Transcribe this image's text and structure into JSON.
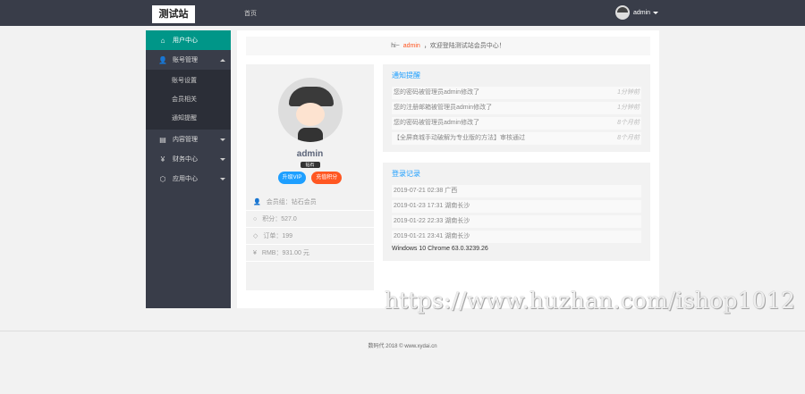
{
  "header": {
    "logo": "测试站",
    "home": "首页",
    "username": "admin"
  },
  "sidebar": {
    "items": [
      {
        "label": "用户中心",
        "icon": "home-icon",
        "active": true
      },
      {
        "label": "账号管理",
        "icon": "user-icon",
        "expanded": true,
        "children": [
          "账号设置",
          "会员相关",
          "通知提醒"
        ]
      },
      {
        "label": "内容管理",
        "icon": "list-icon"
      },
      {
        "label": "财务中心",
        "icon": "yen-icon"
      },
      {
        "label": "应用中心",
        "icon": "cube-icon"
      }
    ]
  },
  "welcome": {
    "prefix": "hi~",
    "name": "admin",
    "suffix": "，欢迎登陆测试站会员中心！"
  },
  "profile": {
    "name": "admin",
    "badge": "钻石",
    "upgrade": "升级VIP",
    "recharge": "充值积分",
    "stats": [
      "会员组：钻石会员",
      "积分：527.0",
      "订单：199",
      "RMB：931.00 元"
    ]
  },
  "notices": {
    "title": "通知提醒",
    "items": [
      {
        "text": "您的密码被管理员admin修改了",
        "time": "1分钟前"
      },
      {
        "text": "您的注册邮箱被管理员admin修改了",
        "time": "1分钟前"
      },
      {
        "text": "您的密码被管理员admin修改了",
        "time": "8个月前"
      },
      {
        "text": "【全屏商城手动破解为专业版的方法】审核通过",
        "time": "8个月前"
      }
    ]
  },
  "logins": {
    "title": "登录记录",
    "items": [
      "2019-07-21 02:38 广西",
      "2019-01-23 17:31 湖南长沙",
      "2019-01-22 22:33 湖南长沙",
      "2019-01-21 23:41 湖南长沙"
    ],
    "ua": "Windows 10 Chrome 63.0.3239.26"
  },
  "footer": "数码代 2018 © www.xydai.cn",
  "watermark": "https://www.huzhan.com/ishop1012",
  "colors": {
    "header": "#393d49",
    "active": "#009688",
    "blue": "#1e9fff",
    "orange": "#ff5722"
  }
}
